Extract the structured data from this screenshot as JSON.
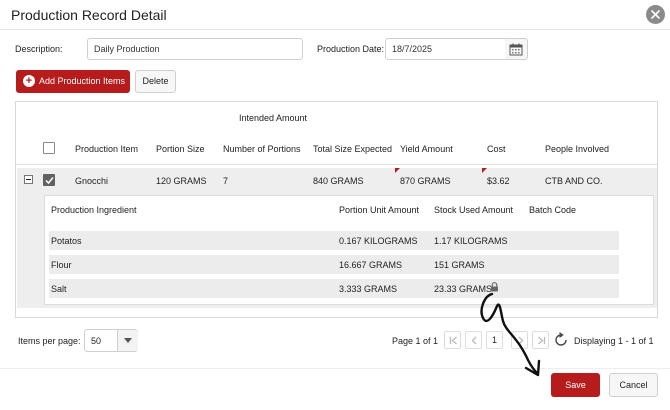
{
  "dialog": {
    "title": "Production Record Detail",
    "close_icon": "close-icon"
  },
  "form": {
    "description_label": "Description:",
    "description_value": "Daily Production",
    "production_date_label": "Production Date:",
    "production_date_value": "18/7/2025",
    "calendar_icon": "calendar-icon"
  },
  "toolbar": {
    "add_label": "Add Production Items",
    "delete_label": "Delete",
    "accent_color": "#b71c1c"
  },
  "grid": {
    "group_header": "Intended Amount",
    "columns": [
      "Production Item",
      "Portion Size",
      "Number of Portions",
      "Total Size Expected",
      "Yield Amount",
      "Cost",
      "People Involved"
    ],
    "rows": [
      {
        "item": "Gnocchi",
        "portion_size": "120 GRAMS",
        "portions": "7",
        "total_expected": "840 GRAMS",
        "yield": "870 GRAMS",
        "cost": "$3.62",
        "people": "CTB AND CO.",
        "checked": true,
        "expanded": true
      }
    ],
    "detail": {
      "columns": [
        "Production Ingredient",
        "Portion Unit Amount",
        "Stock Used Amount",
        "Batch Code"
      ],
      "rows": [
        {
          "ingredient": "Potatos",
          "portion_unit": "0.167 KILOGRAMS",
          "stock_used": "1.17 KILOGRAMS",
          "batch": ""
        },
        {
          "ingredient": "Flour",
          "portion_unit": "16.667 GRAMS",
          "stock_used": "151 GRAMS",
          "batch": ""
        },
        {
          "ingredient": "Salt",
          "portion_unit": "3.333 GRAMS",
          "stock_used": "23.33 GRAMS",
          "batch": "",
          "locked": true
        }
      ]
    }
  },
  "pager": {
    "items_per_page_label": "Items per page:",
    "items_per_page_value": "50",
    "page_info": "Page 1 of 1",
    "current_page": "1",
    "display_info": "Displaying 1 - 1 of 1"
  },
  "footer": {
    "save_label": "Save",
    "cancel_label": "Cancel"
  }
}
